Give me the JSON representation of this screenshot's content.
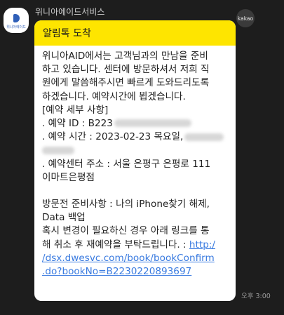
{
  "sender": {
    "name": "위니아에이드서비스",
    "avatar_text": "위니아에이드"
  },
  "badge": {
    "label": "kakao"
  },
  "message": {
    "header": "알림톡 도착",
    "lines": [
      "위니아AID에서는 고객님과의 만남을 준비",
      "하고 있습니다. 센터에 방문하셔서 저희 직",
      "원에게 말씀해주시면 빠르게 도와드리도록",
      "하겠습니다. 예약시간에 뵙겠습니다.",
      "[예약 세부 사항]",
      ". 예약 ID : B223",
      ". 예약 시간 : 2023-02-23  목요일,",
      ". 예약센터 주소 : 서울 은평구 은평로 111",
      "이마트은평점",
      "방문전 준비사항 : 나의 iPhone찾기 해제,",
      "Data 백업",
      "혹시 변경이 필요하신 경우 아래 링크를 통",
      "해 취소 후 재예약을 부탁드립니다. : "
    ],
    "link_lines": [
      "http:/",
      "/dsx.dwesvc.com/book/bookConfirm",
      ".do?bookNo=B2230220893697"
    ]
  },
  "timestamp": "오후 3:00",
  "colors": {
    "background": "#1d1d1d",
    "header_yellow": "#fee500",
    "link_blue": "#3a7be0"
  }
}
